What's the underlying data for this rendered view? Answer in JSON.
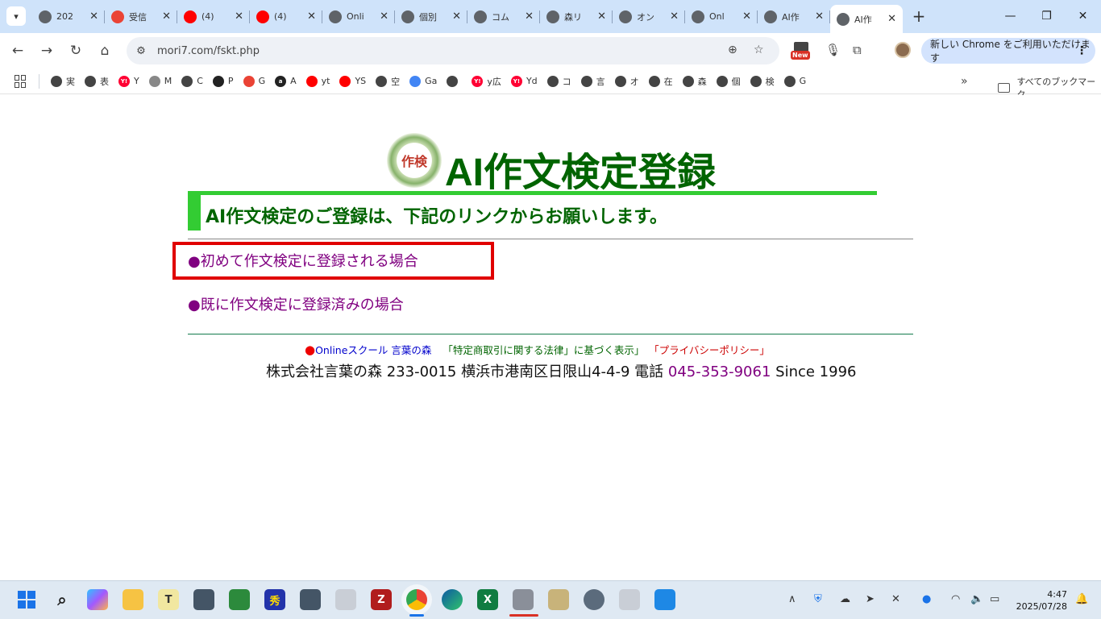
{
  "browser": {
    "tabs": [
      {
        "title": "202",
        "favicon": "globe-icon",
        "color": "#5f6368"
      },
      {
        "title": "受信",
        "favicon": "gmail-icon",
        "color": "#ea4335"
      },
      {
        "title": "(4) ",
        "favicon": "youtube-icon",
        "color": "#ff0000"
      },
      {
        "title": "(4) ",
        "favicon": "youtube-icon",
        "color": "#ff0000"
      },
      {
        "title": "Onli",
        "favicon": "openai-icon",
        "color": "#5f6368"
      },
      {
        "title": "個別",
        "favicon": "globe-icon",
        "color": "#5f6368"
      },
      {
        "title": "コム",
        "favicon": "openai-icon",
        "color": "#5f6368"
      },
      {
        "title": "森リ",
        "favicon": "globe-icon",
        "color": "#5f6368"
      },
      {
        "title": "オン",
        "favicon": "globe-icon",
        "color": "#5f6368"
      },
      {
        "title": "Onl",
        "favicon": "globe-icon",
        "color": "#5f6368"
      },
      {
        "title": "AI作",
        "favicon": "globe-icon",
        "color": "#5f6368"
      },
      {
        "title": "AI作",
        "favicon": "globe-icon",
        "color": "#5f6368",
        "active": true
      }
    ],
    "new_tab": "+",
    "address": "mori7.com/fskt.php",
    "new_badge": "New",
    "update_button": "新しい Chrome をご利用いただけます",
    "bookmarks": [
      {
        "label": "実",
        "icon": "globe-icon",
        "color": "#444"
      },
      {
        "label": "表",
        "icon": "globe-icon",
        "color": "#444"
      },
      {
        "label": "Y",
        "icon": "yahoo-icon",
        "color": "#ff0033",
        "glyph": "Y!"
      },
      {
        "label": "M",
        "icon": "m-icon",
        "color": "#888"
      },
      {
        "label": "C",
        "icon": "openai-icon",
        "color": "#444"
      },
      {
        "label": "P",
        "icon": "p-icon",
        "color": "#222"
      },
      {
        "label": "G",
        "icon": "gmail-icon",
        "color": "#ea4335"
      },
      {
        "label": "A",
        "icon": "amazon-icon",
        "color": "#222",
        "glyph": "a"
      },
      {
        "label": "yt",
        "icon": "youtube-icon",
        "color": "#ff0000"
      },
      {
        "label": "YS",
        "icon": "youtube-icon",
        "color": "#ff0000"
      },
      {
        "label": "空",
        "icon": "globe-icon",
        "color": "#444"
      },
      {
        "label": "Ga",
        "icon": "google-ads-icon",
        "color": "#4285f4"
      },
      {
        "label": "",
        "icon": "globe-icon",
        "color": "#444"
      },
      {
        "label": "y広",
        "icon": "yahoo-icon",
        "color": "#ff0033",
        "glyph": "Y!"
      },
      {
        "label": "Yd",
        "icon": "yahoo-icon",
        "color": "#ff0033",
        "glyph": "Y!"
      },
      {
        "label": "コ",
        "icon": "globe-icon",
        "color": "#444"
      },
      {
        "label": "言",
        "icon": "globe-icon",
        "color": "#444"
      },
      {
        "label": "オ",
        "icon": "globe-icon",
        "color": "#444"
      },
      {
        "label": "在",
        "icon": "globe-icon",
        "color": "#444"
      },
      {
        "label": "森",
        "icon": "globe-icon",
        "color": "#444"
      },
      {
        "label": "個",
        "icon": "globe-icon",
        "color": "#444"
      },
      {
        "label": "検",
        "icon": "globe-icon",
        "color": "#444"
      },
      {
        "label": "G",
        "icon": "slash-icon",
        "color": "#444"
      }
    ],
    "all_bookmarks": "すべてのブックマーク"
  },
  "page": {
    "logo_text": "作検",
    "title": "AI作文検定登録",
    "subheading": "AI作文検定のご登録は、下記のリンクからお願いします。",
    "links": [
      {
        "bullet": "●",
        "label": "初めて作文検定に登録される場合"
      },
      {
        "bullet": "●",
        "label": "既に作文検定に登録済みの場合"
      }
    ],
    "footer": {
      "dot": "●",
      "school": "Onlineスクール 言葉の森",
      "law": "「特定商取引に関する法律」に基づく表示」",
      "privacy": "「プライバシーポリシー」",
      "company": "株式会社言葉の森 233-0015 横浜市港南区日限山4-4-9 電話 ",
      "tel": "045-353-9061",
      "since": " Since 1996"
    },
    "colors": {
      "title": "#006400",
      "accent": "#33cc33",
      "link": "#800080",
      "highlight": "#e00000"
    }
  },
  "taskbar": {
    "time": "4:47",
    "date": "2025/07/28"
  }
}
